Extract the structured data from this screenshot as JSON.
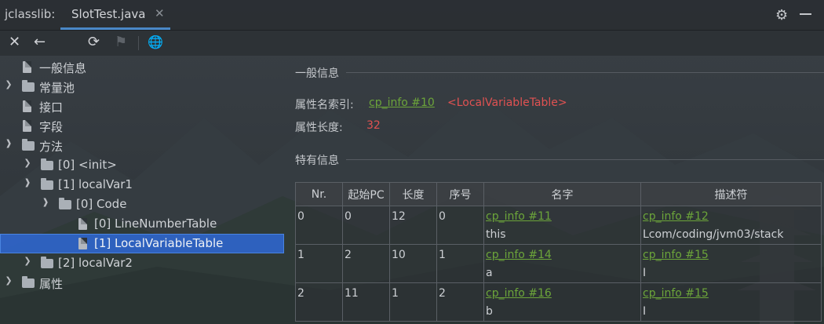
{
  "window": {
    "tool_title": "jclasslib:",
    "tab_label": "SlotTest.java",
    "tab_close": "✕"
  },
  "toolbar": {
    "close": "✕",
    "back": "←",
    "refresh": "⟳",
    "bookmark": "⚑",
    "browser": "🌐"
  },
  "tree": {
    "items": [
      {
        "label": "一般信息"
      },
      {
        "label": "常量池"
      },
      {
        "label": "接口"
      },
      {
        "label": "字段"
      },
      {
        "label": "方法"
      },
      {
        "label": "[0] <init>"
      },
      {
        "label": "[1] localVar1"
      },
      {
        "label": "[0] Code"
      },
      {
        "label": "[0] LineNumberTable"
      },
      {
        "label": "[1] LocalVariableTable"
      },
      {
        "label": "[2] localVar2"
      },
      {
        "label": "属性"
      }
    ]
  },
  "general": {
    "section_title": "一般信息",
    "name_index_label": "属性名索引:",
    "name_index_link": "cp_info #10",
    "name_index_value": "<LocalVariableTable>",
    "length_label": "属性长度:",
    "length_value": "32"
  },
  "specific": {
    "section_title": "特有信息",
    "columns": [
      "Nr.",
      "起始PC",
      "长度",
      "序号",
      "名字",
      "描述符"
    ],
    "rows": [
      {
        "nr": "0",
        "start_pc": "0",
        "length": "12",
        "index": "0",
        "name_link": "cp_info #11",
        "name_value": "this",
        "desc_link": "cp_info #12",
        "desc_value": "Lcom/coding/jvm03/stack"
      },
      {
        "nr": "1",
        "start_pc": "2",
        "length": "10",
        "index": "1",
        "name_link": "cp_info #14",
        "name_value": "a",
        "desc_link": "cp_info #15",
        "desc_value": "I"
      },
      {
        "nr": "2",
        "start_pc": "11",
        "length": "1",
        "index": "2",
        "name_link": "cp_info #16",
        "name_value": "b",
        "desc_link": "cp_info #15",
        "desc_value": "I"
      }
    ]
  },
  "colors": {
    "link": "#6ca53a",
    "highlight_red": "#e05252",
    "selection": "#2f65ca",
    "tab_accent": "#4a88c7"
  }
}
